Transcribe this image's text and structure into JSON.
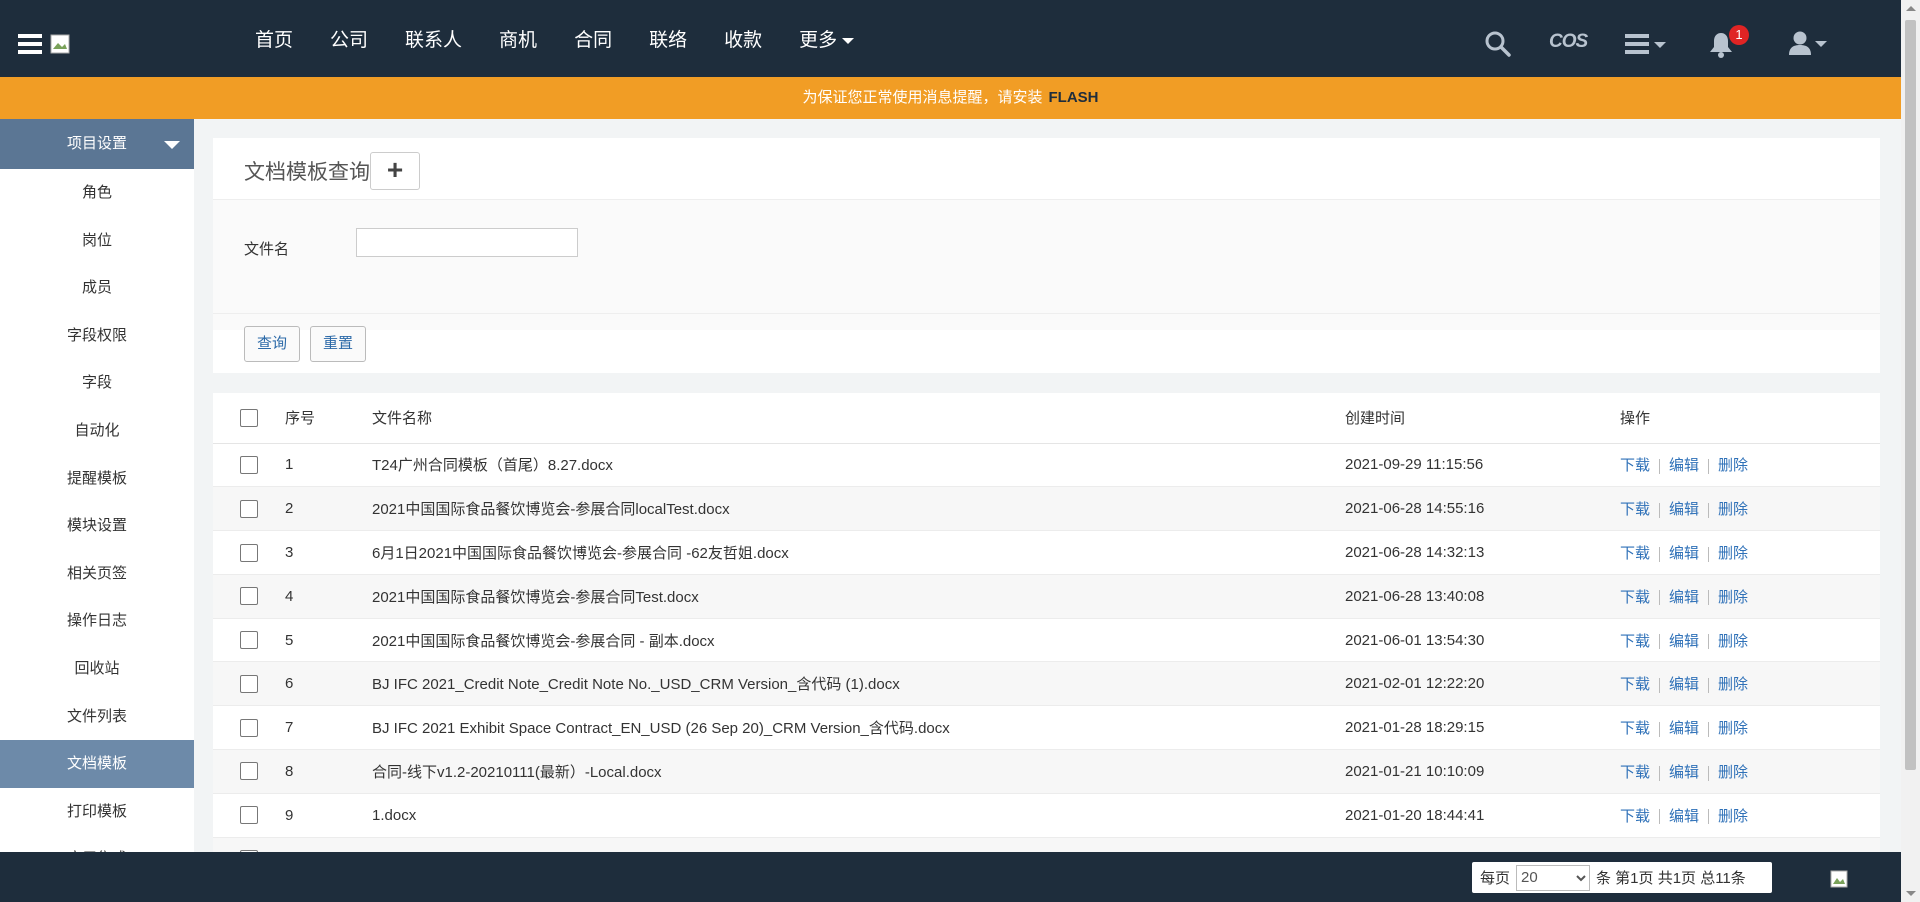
{
  "nav": {
    "items": [
      "首页",
      "公司",
      "联系人",
      "商机",
      "合同",
      "联络",
      "收款",
      "更多"
    ],
    "cos_label": "COS",
    "notification_count": "1"
  },
  "flash": {
    "text": "为保证您正常使用消息提醒，请安装",
    "highlight": "FLASH"
  },
  "sidebar": {
    "section_title": "项目设置",
    "items": [
      "角色",
      "岗位",
      "成员",
      "字段权限",
      "字段",
      "自动化",
      "提醒模板",
      "模块设置",
      "相关页签",
      "操作日志",
      "回收站",
      "文件列表",
      "文档模板",
      "打印模板",
      "应用集成"
    ],
    "active_index": 12
  },
  "search": {
    "title": "文档模板查询",
    "add_symbol": "+",
    "field_label": "文件名",
    "field_value": "",
    "query_label": "查询",
    "reset_label": "重置"
  },
  "table": {
    "headers": {
      "seq": "序号",
      "name": "文件名称",
      "time": "创建时间",
      "ops": "操作"
    },
    "actions": {
      "download": "下载",
      "edit": "编辑",
      "delete": "删除"
    },
    "rows": [
      {
        "seq": "1",
        "name": "T24广州合同模板（首尾）8.27.docx",
        "time": "2021-09-29 11:15:56"
      },
      {
        "seq": "2",
        "name": "2021中国国际食品餐饮博览会-参展合同localTest.docx",
        "time": "2021-06-28 14:55:16"
      },
      {
        "seq": "3",
        "name": "6月1日2021中国国际食品餐饮博览会-参展合同 -62友哲姐.docx",
        "time": "2021-06-28 14:32:13"
      },
      {
        "seq": "4",
        "name": "2021中国国际食品餐饮博览会-参展合同Test.docx",
        "time": "2021-06-28 13:40:08"
      },
      {
        "seq": "5",
        "name": "2021中国国际食品餐饮博览会-参展合同 - 副本.docx",
        "time": "2021-06-01 13:54:30"
      },
      {
        "seq": "6",
        "name": "BJ IFC 2021_Credit Note_Credit Note No._USD_CRM Version_含代码 (1).docx",
        "time": "2021-02-01 12:22:20"
      },
      {
        "seq": "7",
        "name": "BJ IFC 2021 Exhibit Space Contract_EN_USD (26 Sep 20)_CRM Version_含代码.docx",
        "time": "2021-01-28 18:29:15"
      },
      {
        "seq": "8",
        "name": "合同-线下v1.2-20210111(最新）-Local.docx",
        "time": "2021-01-21 10:10:09"
      },
      {
        "seq": "9",
        "name": "1.docx",
        "time": "2021-01-20 18:44:41"
      },
      {
        "seq": "",
        "name": "",
        "time": ""
      }
    ]
  },
  "pager": {
    "per_page_label": "每页",
    "per_page_value": "20",
    "status_text": "条 第1页 共1页 总11条"
  },
  "colors": {
    "topbar": "#1e2d3c",
    "flash": "#f19d25",
    "sidebar_header": "#5b7694",
    "sidebar_active": "#6d8aa9",
    "link": "#2f71b8"
  }
}
